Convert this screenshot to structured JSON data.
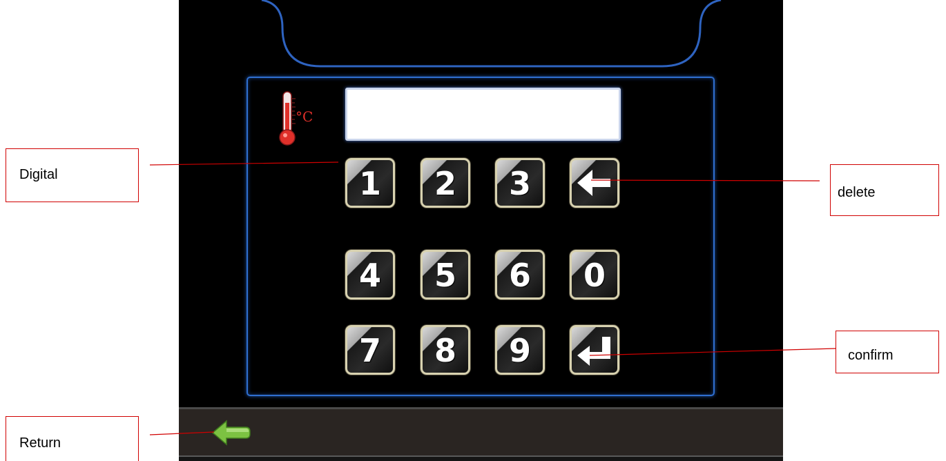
{
  "display": {
    "value": ""
  },
  "thermometer": {
    "unit_label": "°C"
  },
  "keypad": {
    "keys": [
      {
        "label": "1",
        "type": "digit"
      },
      {
        "label": "2",
        "type": "digit"
      },
      {
        "label": "3",
        "type": "digit"
      },
      {
        "label": "",
        "type": "delete",
        "icon": "arrow-left-icon"
      },
      {
        "label": "4",
        "type": "digit"
      },
      {
        "label": "5",
        "type": "digit"
      },
      {
        "label": "6",
        "type": "digit"
      },
      {
        "label": "0",
        "type": "digit"
      },
      {
        "label": "7",
        "type": "digit"
      },
      {
        "label": "8",
        "type": "digit"
      },
      {
        "label": "9",
        "type": "digit"
      },
      {
        "label": "",
        "type": "confirm",
        "icon": "enter-icon"
      }
    ]
  },
  "return_button": {
    "icon": "green-arrow-left-icon"
  },
  "callouts": {
    "digital": "Digital",
    "delete": "delete",
    "confirm": "confirm",
    "return": "Return"
  },
  "colors": {
    "screen_bg": "#000000",
    "panel_border": "#2f6fd0",
    "callout_line": "#d00000",
    "return_arrow": "#7cc242",
    "thermometer_red": "#e0302a"
  }
}
